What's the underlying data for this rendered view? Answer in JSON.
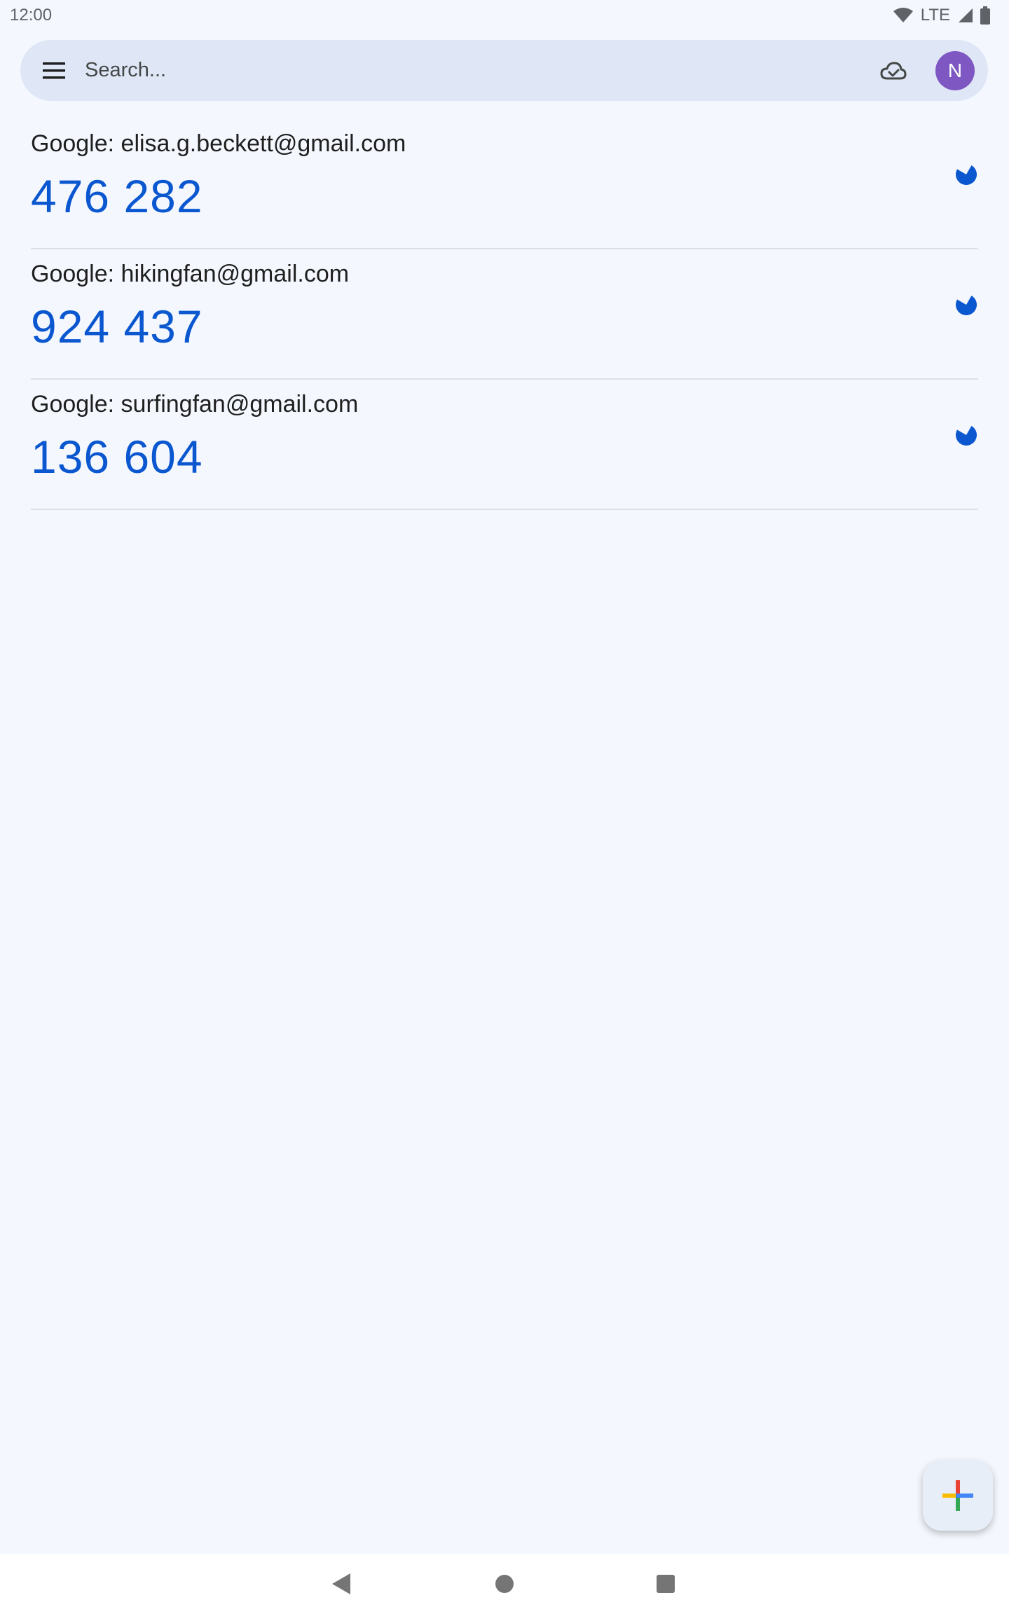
{
  "status_bar": {
    "time": "12:00",
    "network": "LTE"
  },
  "search": {
    "placeholder": "Search..."
  },
  "avatar": {
    "initial": "N",
    "color": "#7e57c2"
  },
  "accounts": [
    {
      "name": "Google: elisa.g.beckett@gmail.com",
      "code": "476 282"
    },
    {
      "name": "Google: hikingfan@gmail.com",
      "code": "924 437"
    },
    {
      "name": "Google: surfingfan@gmail.com",
      "code": "136 604"
    }
  ],
  "colors": {
    "accent": "#0b57d0",
    "background": "#f4f8fe",
    "search_bar": "#dfe7f7"
  },
  "icons": {
    "menu": "menu-icon",
    "cloud": "cloud-sync-icon",
    "timer": "countdown-timer-icon",
    "fab": "add-plus-icon"
  }
}
